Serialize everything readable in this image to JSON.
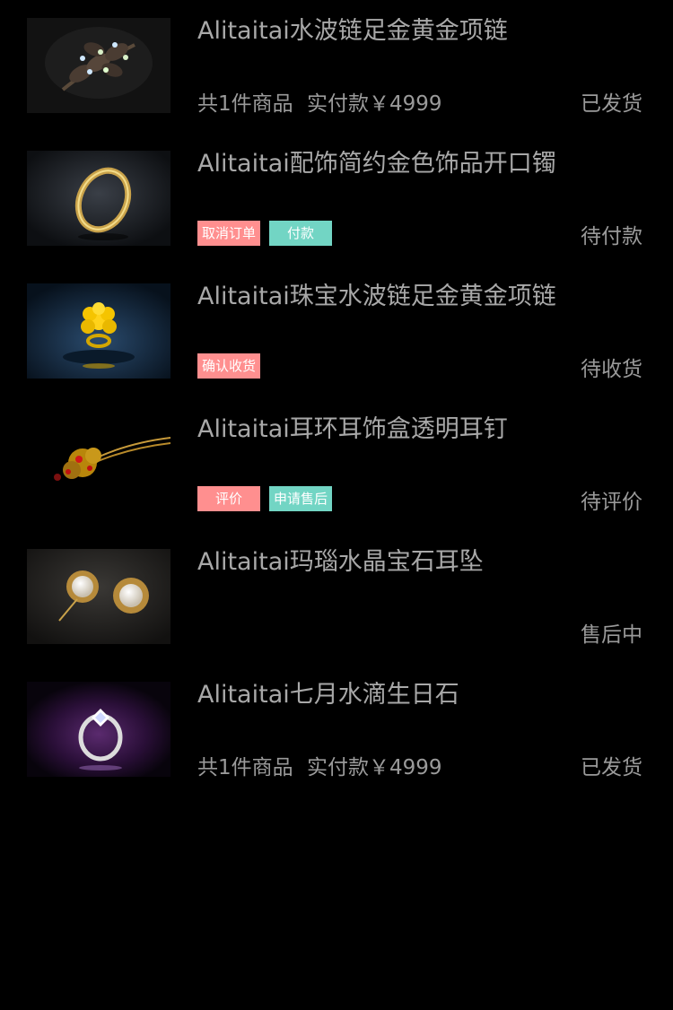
{
  "orders": [
    {
      "title": "Alitaitai水波链足金黄金项链",
      "summary_count": "共1件商品",
      "summary_paid": "实付款￥4999",
      "status": "已发货",
      "image_icon": "leaf-brooch"
    },
    {
      "title": "Alitaitai配饰简约金色饰品开口镯",
      "buttons": [
        "取消订单",
        "付款"
      ],
      "status": "待付款",
      "image_icon": "gold-ring"
    },
    {
      "title": "Alitaitai珠宝水波链足金黄金项链",
      "buttons": [
        "确认收货"
      ],
      "status": "待收货",
      "image_icon": "gold-flower-ring"
    },
    {
      "title": "Alitaitai耳环耳饰盒透明耳钉",
      "buttons": [
        "评价",
        "申请售后"
      ],
      "status": "待评价",
      "image_icon": "hairpin"
    },
    {
      "title": "Alitaitai玛瑙水晶宝石耳坠",
      "status": "售后中",
      "image_icon": "pearl-earrings"
    },
    {
      "title": "Alitaitai七月水滴生日石",
      "summary_count": "共1件商品",
      "summary_paid": "实付款￥4999",
      "status": "已发货",
      "image_icon": "diamond-ring"
    }
  ],
  "colors": {
    "background": "#000000",
    "text": "#a8a8a8",
    "button_pink": "#ff8f8f",
    "button_teal": "#72d5c4"
  }
}
